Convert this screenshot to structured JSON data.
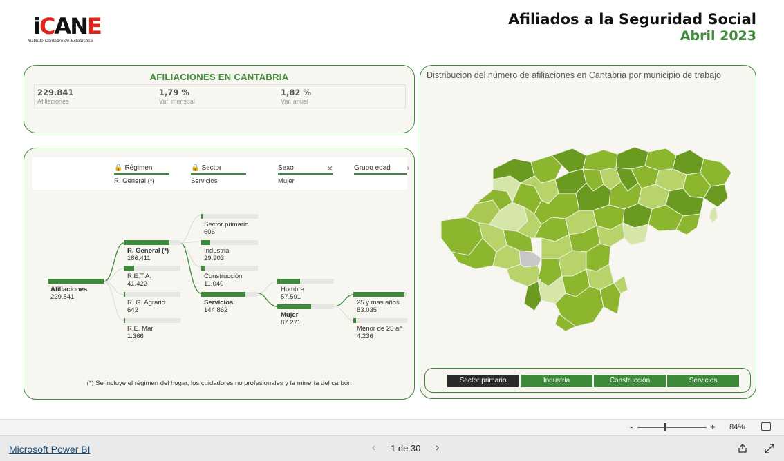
{
  "header": {
    "title": "Afiliados a la Seguridad Social",
    "subtitle": "Abril 2023",
    "logo_text": "ICANE",
    "logo_subtitle": "Instituto Cántabro de Estadística"
  },
  "kpi": {
    "title": "AFILIACIONES EN CANTABRIA",
    "items": [
      {
        "value": "229.841",
        "label": "Afiliaciones"
      },
      {
        "value": "1,79 %",
        "label": "Var. mensual"
      },
      {
        "value": "1,82 %",
        "label": "Var. anual"
      }
    ]
  },
  "filters": [
    {
      "name": "Régimen",
      "value": "R. General (*)",
      "icon": "lock-icon"
    },
    {
      "name": "Sector",
      "value": "Servicios",
      "icon": "lock-icon"
    },
    {
      "name": "Sexo",
      "value": "Mujer",
      "icon": "close-icon"
    },
    {
      "name": "Grupo edad",
      "value": "",
      "icon": "chevron-right-icon"
    }
  ],
  "tree": {
    "root": {
      "label": "Afiliaciones",
      "value": "229.841",
      "fill": 1.0
    },
    "regimen": [
      {
        "label": "R. General (*)",
        "value": "186.411",
        "fill": 0.81,
        "selected": true
      },
      {
        "label": "R.E.T.A.",
        "value": "41.422",
        "fill": 0.18
      },
      {
        "label": "R. G. Agrario",
        "value": "642",
        "fill": 0.01
      },
      {
        "label": "R.E. Mar",
        "value": "1.366",
        "fill": 0.01
      }
    ],
    "sector": [
      {
        "label": "Sector primario",
        "value": "606",
        "fill": 0.01
      },
      {
        "label": "Industria",
        "value": "29.903",
        "fill": 0.16
      },
      {
        "label": "Construcción",
        "value": "11.040",
        "fill": 0.06
      },
      {
        "label": "Servicios",
        "value": "144.862",
        "fill": 0.78,
        "selected": true
      }
    ],
    "sexo": [
      {
        "label": "Hombre",
        "value": "57.591",
        "fill": 0.4
      },
      {
        "label": "Mujer",
        "value": "87.271",
        "fill": 0.6,
        "selected": true
      }
    ],
    "edad": [
      {
        "label": "25 y mas años",
        "value": "83.035",
        "fill": 0.95
      },
      {
        "label": "Menor de 25 añ",
        "value": "4.236",
        "fill": 0.05
      }
    ],
    "footnote": "(*) Se incluye el régimen del hogar, los cuidadores no profesionales y la minería del carbón"
  },
  "map": {
    "title": "Distribucion del número de afiliaciones en Cantabria por municipio de trabajo",
    "legend": [
      "Sector primario",
      "Industria",
      "Construcción",
      "Servicios"
    ],
    "legend_active": 0,
    "colors": {
      "dark": "#6a9a1f",
      "mid": "#8cb62d",
      "light": "#b7d36a",
      "pale": "#d6e6a8",
      "none": "#c8c8c8",
      "accent": "#3d8a3a",
      "active_btn": "#2b2b2b"
    }
  },
  "zoom": {
    "level": "84%",
    "minus": "-",
    "plus": "+"
  },
  "footer": {
    "brand": "Microsoft Power BI",
    "page": "1 de 30"
  }
}
